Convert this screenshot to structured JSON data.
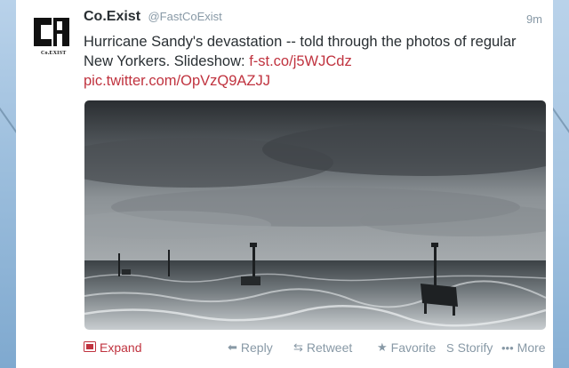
{
  "tweet": {
    "author_name": "Co.Exist",
    "handle": "@FastCoExist",
    "time": "9m",
    "avatar_logo_text": "Co.EXIST",
    "text_line1": "Hurricane Sandy's devastation -- told through the photos of regular",
    "text_line2_prefix": "New Yorkers. Slideshow: ",
    "link1": "f-st.co/j5WJCdz",
    "link2": "pic.twitter.com/OpVzQ9AZJJ"
  },
  "actions": {
    "expand": "Expand",
    "reply": "Reply",
    "retweet": "Retweet",
    "favorite": "Favorite",
    "storify": "Storify",
    "more": "More"
  },
  "icons": {
    "expand": "photo-icon",
    "reply": "reply-arrow-icon",
    "retweet": "retweet-icon",
    "favorite": "star-icon",
    "storify": "storify-icon",
    "more": "ellipsis-icon"
  },
  "colors": {
    "link": "#c0333f",
    "muted": "#8899a6",
    "text": "#292f33"
  }
}
